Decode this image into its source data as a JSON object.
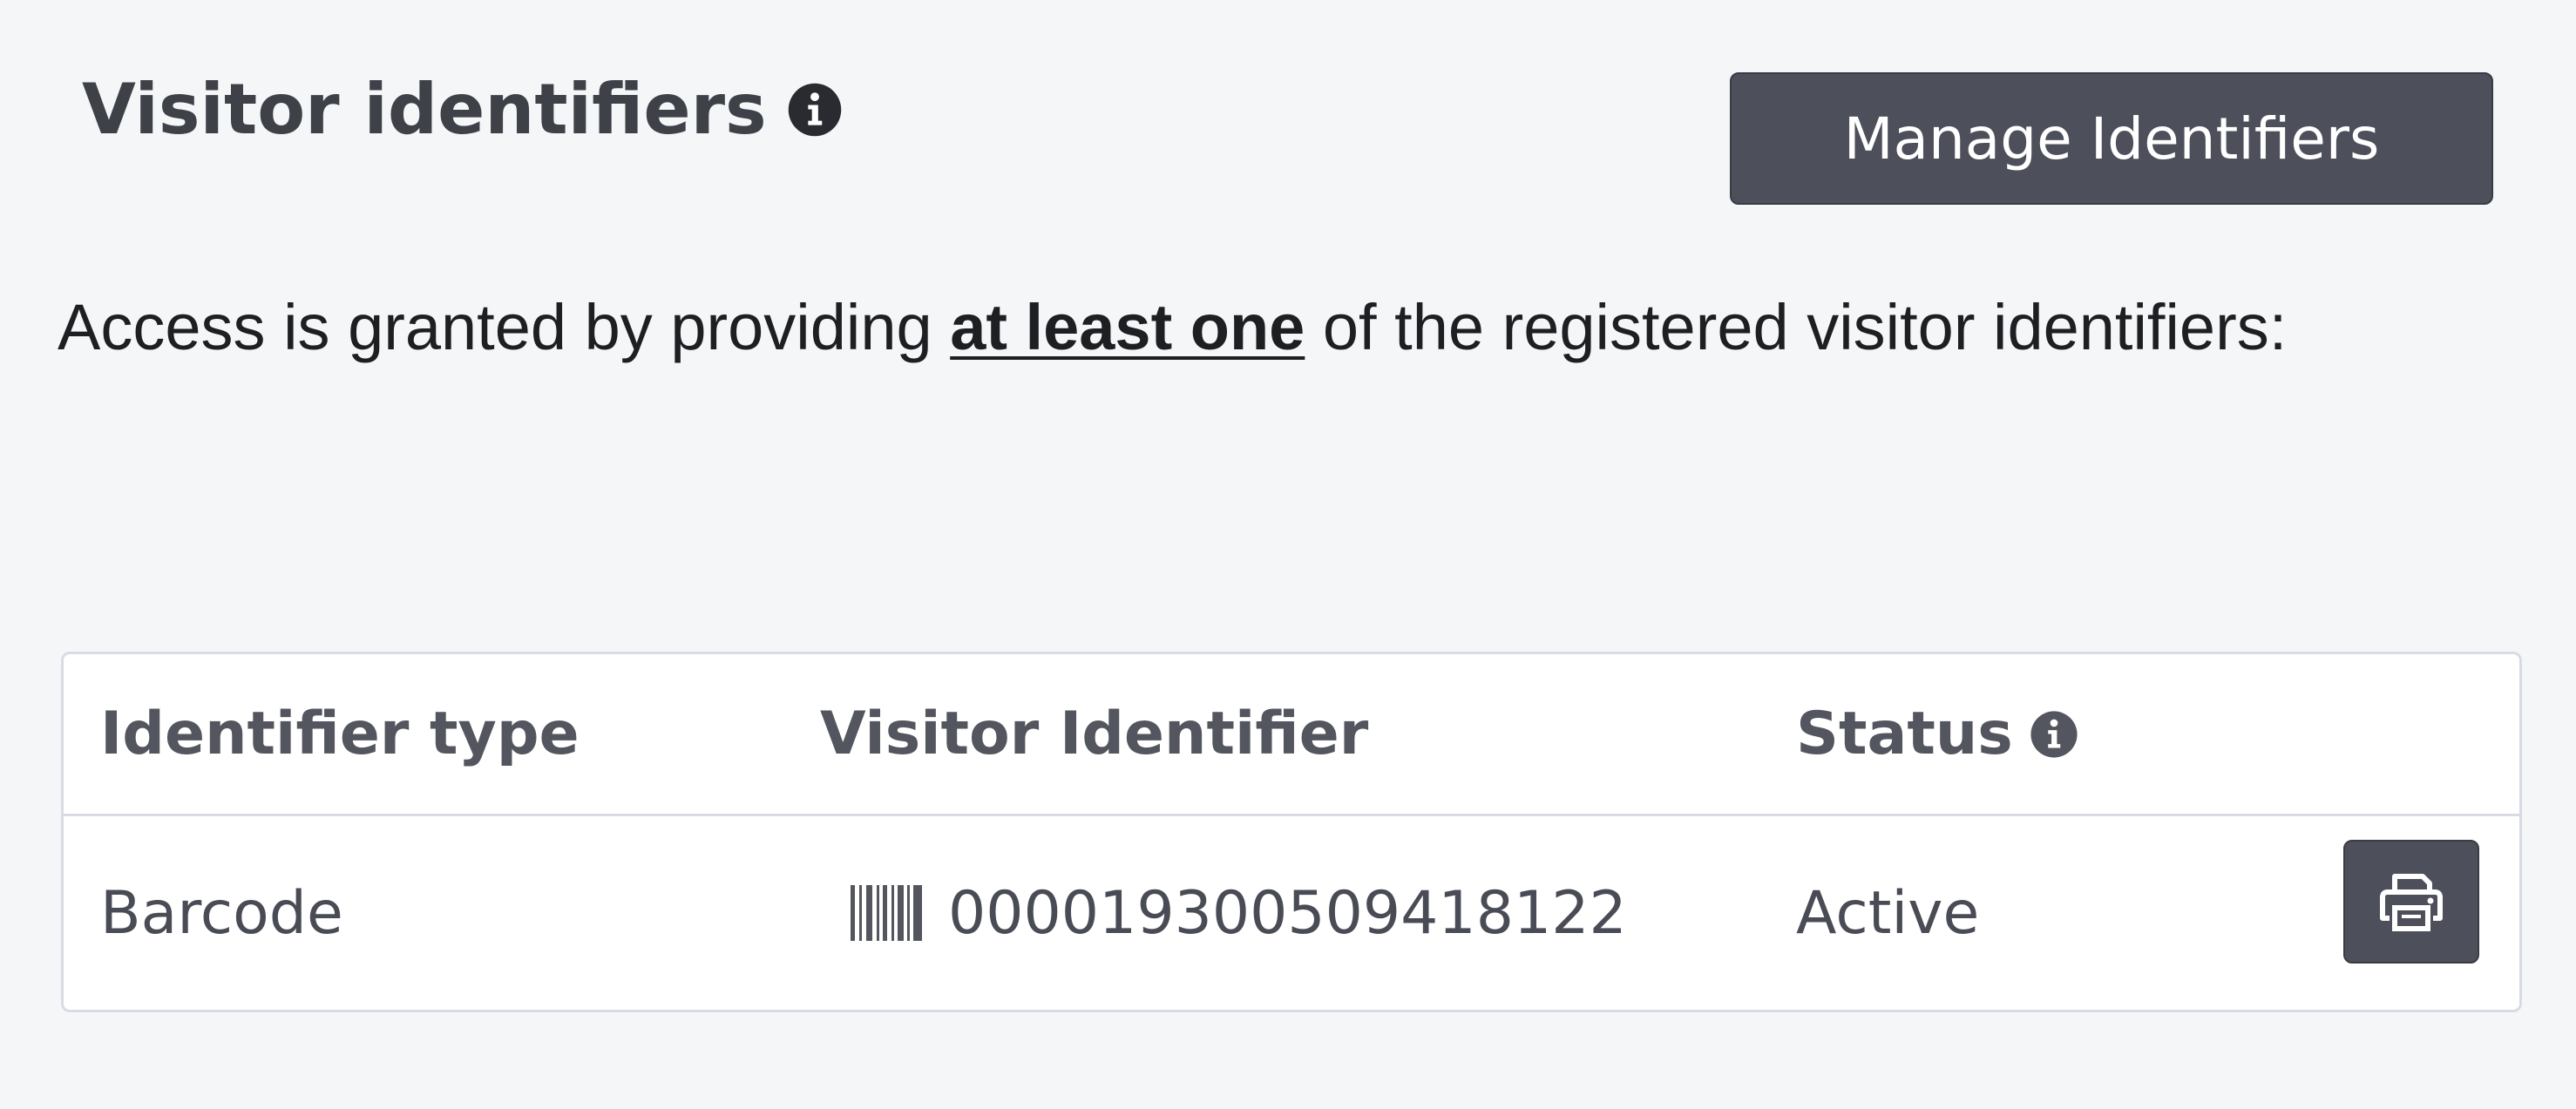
{
  "header": {
    "title": "Visitor identifiers",
    "title_icon": "info-circle-icon",
    "manage_button_label": "Manage Identifiers"
  },
  "description": {
    "prefix": "Access is granted by providing ",
    "emphasis": "at least one",
    "suffix": " of the registered visitor identifiers:"
  },
  "table": {
    "columns": [
      {
        "label": "Identifier type"
      },
      {
        "label": "Visitor Identifier"
      },
      {
        "label": "Status",
        "icon": "info-circle-icon"
      }
    ],
    "rows": [
      {
        "type": "Barcode",
        "identifier_icon": "barcode-icon",
        "identifier": "0000193005094181​22",
        "status": "Active",
        "action_icon": "print-icon"
      }
    ]
  },
  "colors": {
    "background": "#f5f6f8",
    "button": "#4d505b",
    "button_text": "#ffffff",
    "border": "#d9dbe4",
    "text": "#4a4c55"
  }
}
